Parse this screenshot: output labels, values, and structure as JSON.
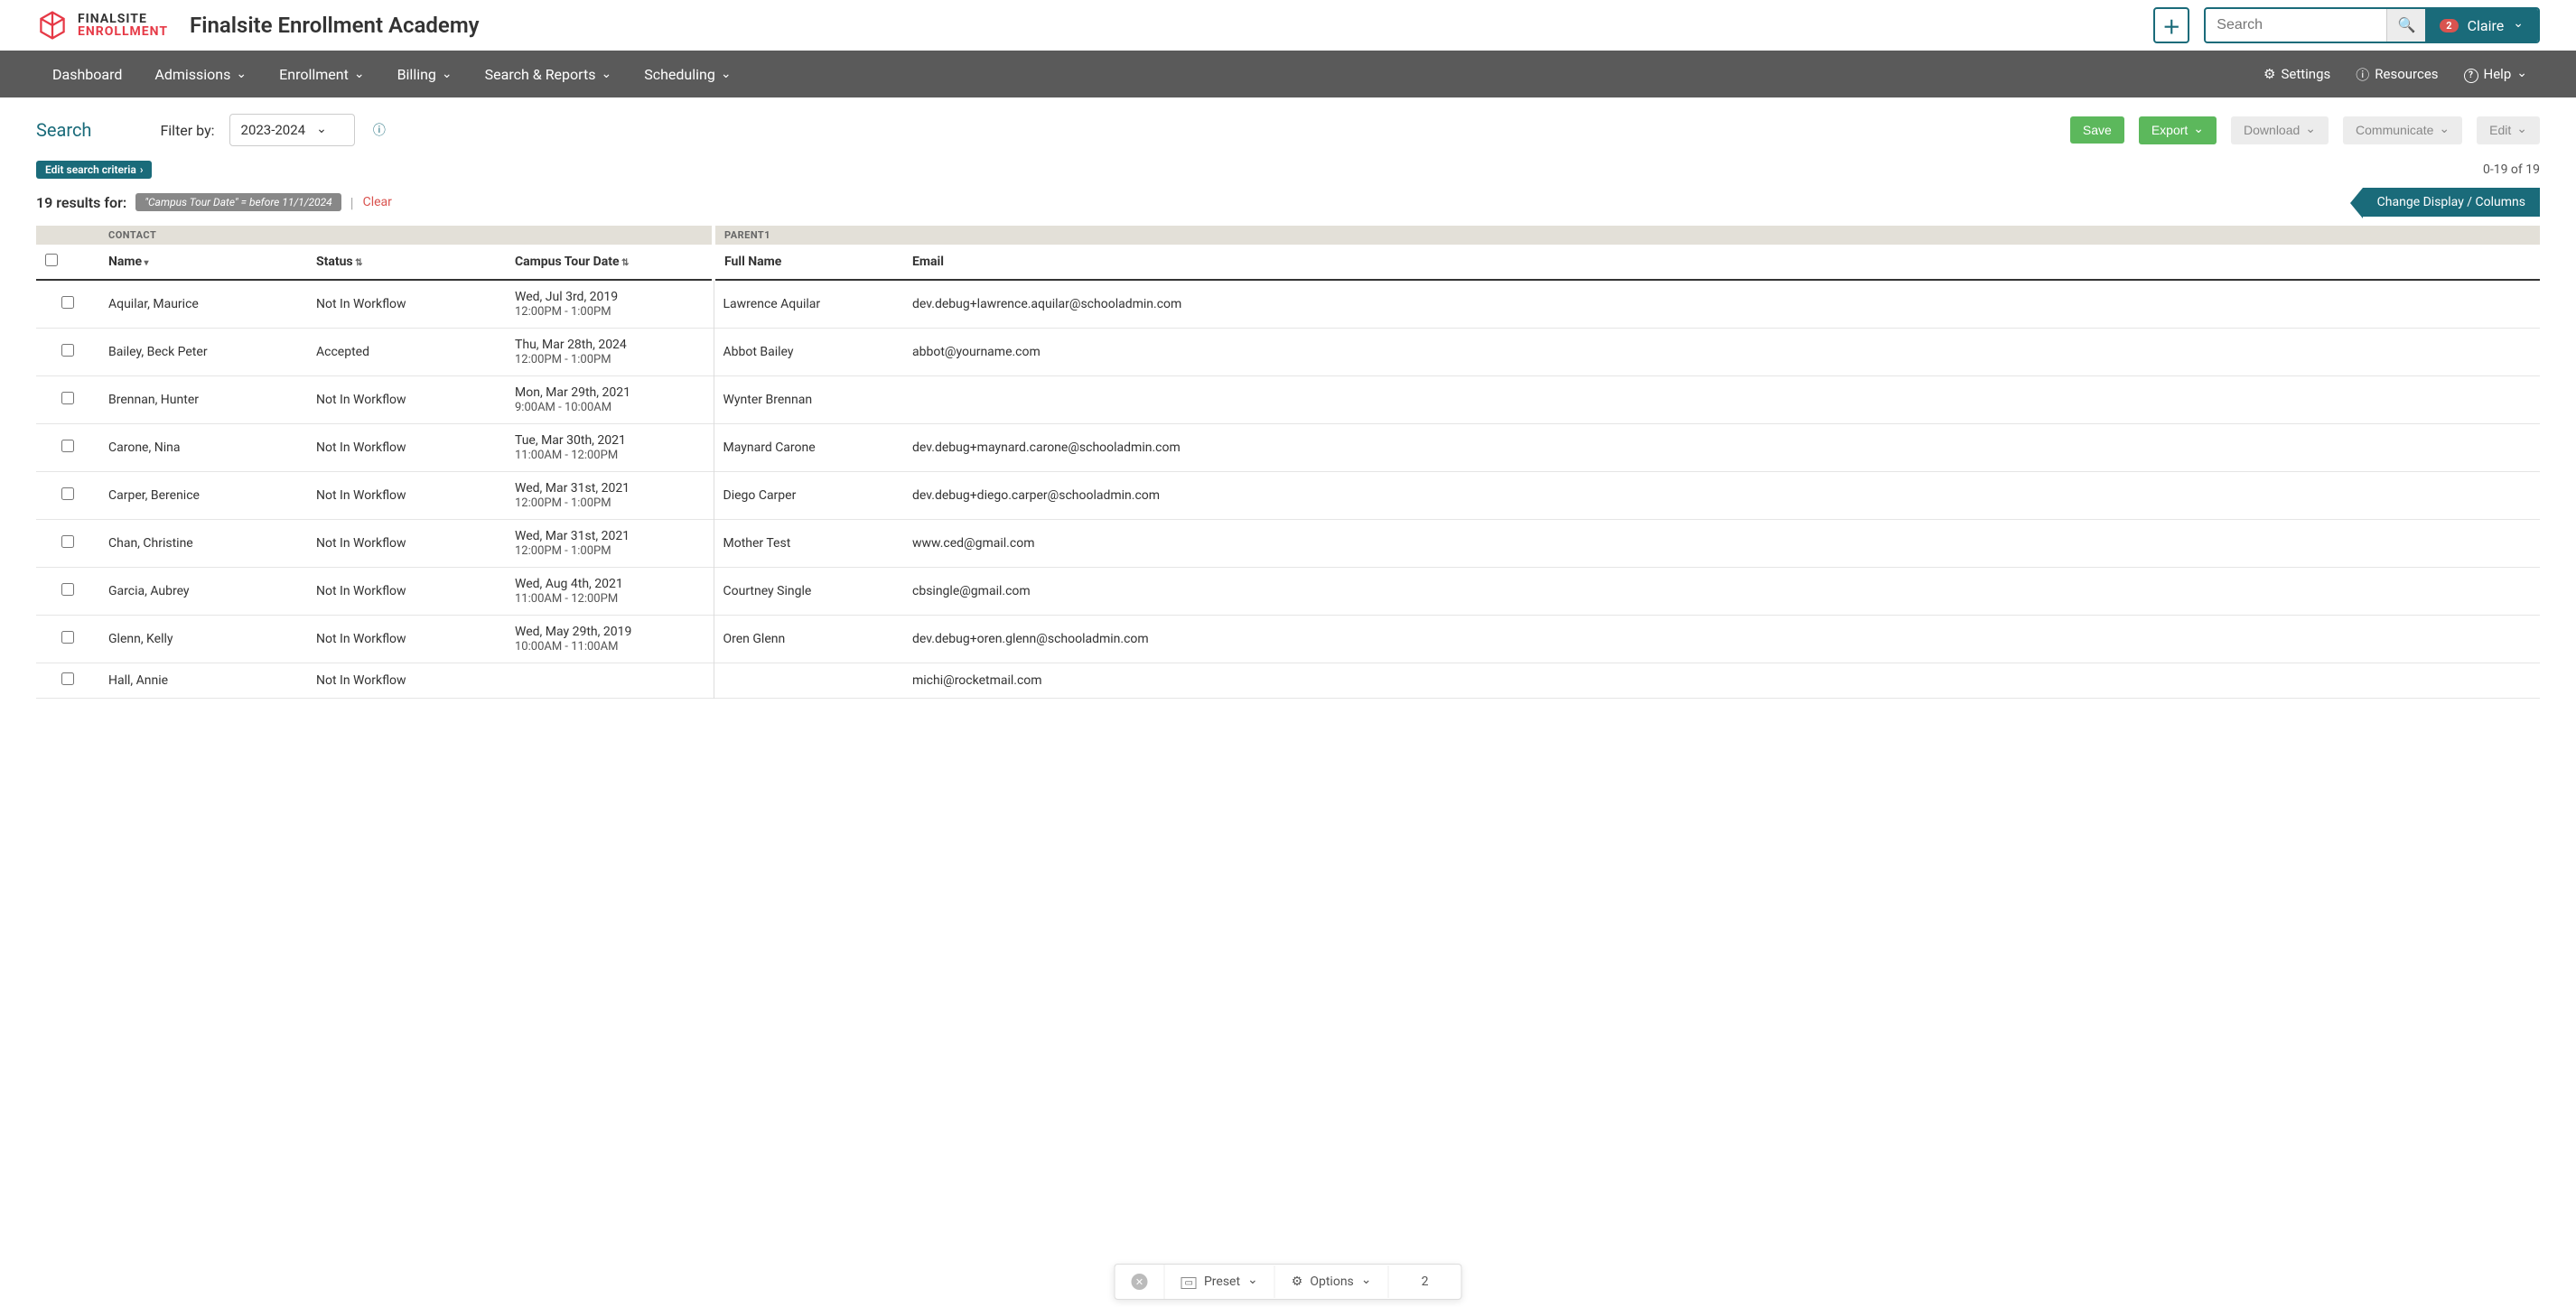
{
  "header": {
    "logo_top": "FINALSITE",
    "logo_bottom": "ENROLLMENT",
    "app_title": "Finalsite Enrollment Academy",
    "search_placeholder": "Search",
    "notification_count": "2",
    "user_name": "Claire"
  },
  "nav": {
    "items": [
      "Dashboard",
      "Admissions",
      "Enrollment",
      "Billing",
      "Search & Reports",
      "Scheduling"
    ],
    "right": {
      "settings": "Settings",
      "resources": "Resources",
      "help": "Help"
    }
  },
  "toolbar": {
    "search_title": "Search",
    "filter_label": "Filter by:",
    "filter_value": "2023-2024",
    "save": "Save",
    "export": "Export",
    "download": "Download",
    "communicate": "Communicate",
    "edit": "Edit"
  },
  "criteria": {
    "edit_label": "Edit search criteria",
    "range": "0-19 of 19",
    "results_prefix": "19 results for:",
    "chip": "\"Campus Tour Date\" = before 11/1/2024",
    "clear": "Clear",
    "change_display": "Change Display / Columns"
  },
  "table": {
    "groups": {
      "contact": "CONTACT",
      "parent1": "PARENT1"
    },
    "columns": {
      "name": "Name",
      "status": "Status",
      "tour": "Campus Tour Date",
      "fullname": "Full Name",
      "email": "Email"
    },
    "rows": [
      {
        "name": "Aquilar, Maurice",
        "status": "Not In Workflow",
        "tour_date": "Wed, Jul 3rd, 2019",
        "tour_time": "12:00PM - 1:00PM",
        "fullname": "Lawrence Aquilar",
        "email": "dev.debug+lawrence.aquilar@schooladmin.com"
      },
      {
        "name": "Bailey, Beck Peter",
        "status": "Accepted",
        "tour_date": "Thu, Mar 28th, 2024",
        "tour_time": "12:00PM - 1:00PM",
        "fullname": "Abbot Bailey",
        "email": "abbot@yourname.com"
      },
      {
        "name": "Brennan, Hunter",
        "status": "Not In Workflow",
        "tour_date": "Mon, Mar 29th, 2021",
        "tour_time": "9:00AM - 10:00AM",
        "fullname": "Wynter Brennan",
        "email": ""
      },
      {
        "name": "Carone, Nina",
        "status": "Not In Workflow",
        "tour_date": "Tue, Mar 30th, 2021",
        "tour_time": "11:00AM - 12:00PM",
        "fullname": "Maynard Carone",
        "email": "dev.debug+maynard.carone@schooladmin.com"
      },
      {
        "name": "Carper, Berenice",
        "status": "Not In Workflow",
        "tour_date": "Wed, Mar 31st, 2021",
        "tour_time": "12:00PM - 1:00PM",
        "fullname": "Diego Carper",
        "email": "dev.debug+diego.carper@schooladmin.com"
      },
      {
        "name": "Chan, Christine",
        "status": "Not In Workflow",
        "tour_date": "Wed, Mar 31st, 2021",
        "tour_time": "12:00PM - 1:00PM",
        "fullname": "Mother Test",
        "email": "www.ced@gmail.com"
      },
      {
        "name": "Garcia, Aubrey",
        "status": "Not In Workflow",
        "tour_date": "Wed, Aug 4th, 2021",
        "tour_time": "11:00AM - 12:00PM",
        "fullname": "Courtney Single",
        "email": "cbsingle@gmail.com"
      },
      {
        "name": "Glenn, Kelly",
        "status": "Not In Workflow",
        "tour_date": "Wed, May 29th, 2019",
        "tour_time": "10:00AM - 11:00AM",
        "fullname": "Oren Glenn",
        "email": "dev.debug+oren.glenn@schooladmin.com"
      },
      {
        "name": "Hall, Annie",
        "status": "Not In Workflow",
        "tour_date": "",
        "tour_time": "",
        "fullname": "",
        "email": "michi@rocketmail.com"
      }
    ]
  },
  "bottombar": {
    "preset": "Preset",
    "options": "Options",
    "page": "2"
  }
}
